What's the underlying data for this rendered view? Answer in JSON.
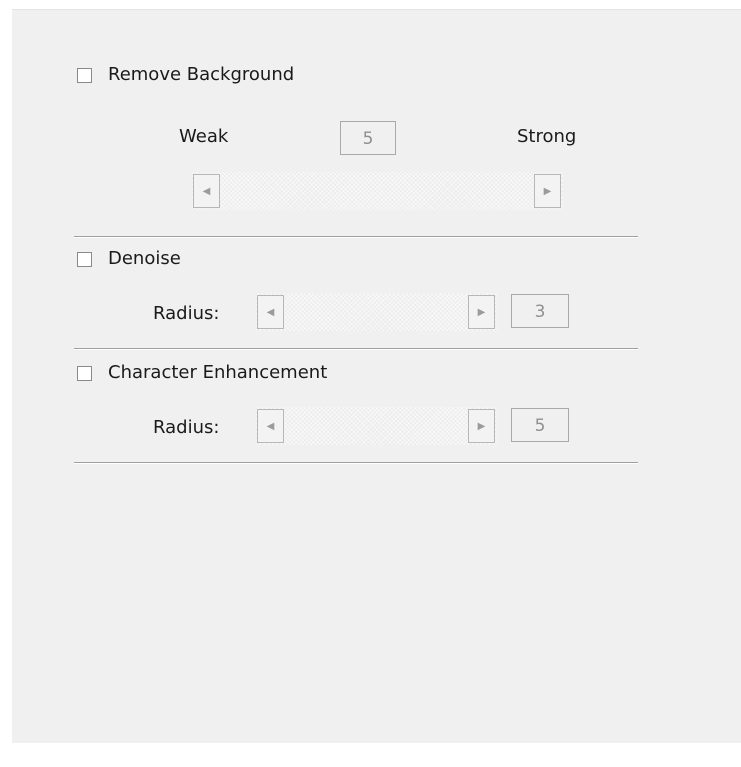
{
  "remove_background": {
    "label": "Remove Background",
    "checked": false,
    "weak_label": "Weak",
    "strong_label": "Strong",
    "value": "5"
  },
  "denoise": {
    "label": "Denoise",
    "checked": false,
    "radius_label": "Radius:",
    "value": "3"
  },
  "character_enhancement": {
    "label": "Character Enhancement",
    "checked": false,
    "radius_label": "Radius:",
    "value": "5"
  },
  "icons": {
    "left_arrow": "left-arrow-icon",
    "right_arrow": "right-arrow-icon"
  }
}
